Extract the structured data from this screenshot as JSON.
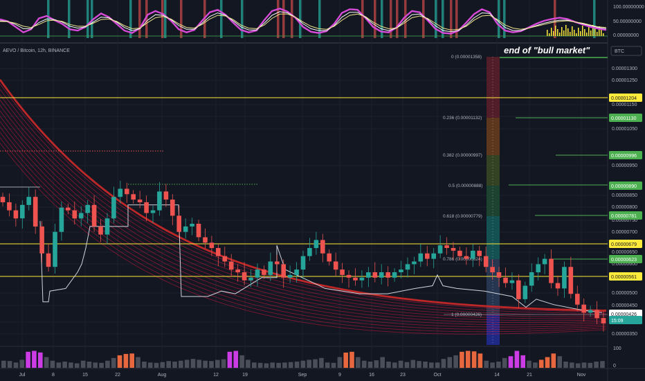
{
  "chart_data": [
    {
      "type": "line",
      "panel": "oscillator",
      "yticks": [
        "100.00000000",
        "50.00000000",
        "0.00000000"
      ],
      "ylim": [
        0,
        100
      ],
      "series": [
        {
          "color": "#d64ad8",
          "values": [
            55,
            48,
            30,
            12,
            22,
            58,
            66,
            52,
            40,
            22,
            18,
            30,
            55,
            74,
            62,
            40,
            18,
            10,
            26,
            70,
            82,
            72,
            50,
            22,
            12,
            20,
            50,
            78,
            86,
            70,
            44,
            20,
            12,
            18,
            52,
            82,
            90,
            80,
            60,
            30,
            14,
            10,
            16,
            40,
            76,
            88,
            86,
            60,
            30,
            15,
            12,
            28,
            60,
            82,
            78,
            52,
            24,
            10,
            8,
            18,
            44,
            72,
            88,
            78,
            40,
            18,
            12,
            16,
            28,
            40,
            50,
            56,
            60,
            56,
            46,
            38,
            30,
            24,
            20
          ]
        },
        {
          "color": "#ffffff",
          "values": [
            50,
            48,
            38,
            24,
            24,
            44,
            56,
            54,
            46,
            32,
            26,
            30,
            46,
            62,
            60,
            46,
            28,
            18,
            24,
            52,
            70,
            68,
            54,
            34,
            22,
            22,
            42,
            64,
            76,
            68,
            50,
            30,
            20,
            20,
            42,
            68,
            80,
            76,
            62,
            40,
            24,
            18,
            18,
            34,
            62,
            78,
            78,
            62,
            40,
            24,
            18,
            26,
            48,
            70,
            72,
            56,
            34,
            18,
            14,
            18,
            36,
            60,
            76,
            74,
            50,
            28,
            18,
            18,
            26,
            34,
            42,
            48,
            52,
            52,
            46,
            40,
            34,
            28,
            24
          ]
        },
        {
          "color": "#f0e68c",
          "values": [
            48,
            47,
            42,
            32,
            28,
            38,
            50,
            52,
            48,
            38,
            32,
            32,
            42,
            54,
            56,
            48,
            34,
            24,
            26,
            44,
            60,
            64,
            56,
            40,
            28,
            26,
            38,
            56,
            68,
            66,
            54,
            36,
            26,
            24,
            36,
            58,
            72,
            72,
            62,
            46,
            32,
            24,
            22,
            32,
            52,
            68,
            72,
            64,
            46,
            32,
            24,
            26,
            42,
            60,
            66,
            58,
            42,
            26,
            20,
            22,
            32,
            52,
            66,
            68,
            54,
            36,
            26,
            22,
            26,
            32,
            38,
            44,
            48,
            50,
            46,
            42,
            36,
            30,
            28
          ]
        }
      ]
    },
    {
      "type": "candlestick",
      "panel": "price",
      "title": "AEVO / Bitcoin, 12h, BINANCE",
      "xlabels": [
        "Jul",
        "8",
        "15",
        "22",
        "Aug",
        "12",
        "19",
        "Sep",
        "9",
        "16",
        "23",
        "Oct",
        "14",
        "21",
        "Nov"
      ],
      "yticks": [
        "0.00001300",
        "0.00001250",
        "0.00001150",
        "0.00001100",
        "0.00001050",
        "0.00000950",
        "0.00000850",
        "0.00000800",
        "0.00000750",
        "0.00000700",
        "0.00000650",
        "0.00000600",
        "0.00000500",
        "0.00000450",
        "0.00000400",
        "0.00000350"
      ],
      "ylim": [
        3.2e-06,
        1.39e-05
      ],
      "close": [
        8.5,
        8.2,
        7.9,
        8.4,
        8.7,
        7.6,
        6.6,
        6.1,
        7.4,
        8.3,
        8.2,
        7.9,
        8.1,
        8.4,
        7.6,
        7.3,
        7.9,
        8.7,
        9.0,
        8.8,
        8.6,
        8.5,
        8.1,
        8.2,
        8.9,
        8.6,
        8.0,
        7.4,
        7.6,
        7.7,
        7.2,
        7.0,
        6.8,
        6.5,
        6.3,
        6.0,
        5.9,
        5.6,
        5.7,
        6.0,
        5.8,
        6.3,
        6.2,
        5.7,
        5.8,
        6.0,
        6.5,
        6.8,
        7.1,
        6.6,
        6.3,
        6.0,
        5.8,
        5.7,
        5.6,
        5.7,
        5.9,
        5.7,
        5.9,
        5.7,
        5.9,
        6.0,
        6.2,
        6.3,
        6.6,
        6.4,
        6.6,
        6.9,
        6.8,
        6.7,
        6.5,
        6.4,
        6.7,
        6.5,
        6.1,
        5.9,
        5.7,
        5.5,
        5.6,
        4.9,
        5.4,
        5.9,
        6.2,
        6.4,
        5.5,
        5.3,
        6.1,
        5.1,
        4.7,
        4.4,
        4.5,
        4.2,
        4.0
      ]
    },
    {
      "type": "bar",
      "panel": "volume",
      "yticks": [
        "100",
        "0"
      ],
      "ylim": [
        0,
        120
      ],
      "values": [
        40,
        38,
        30,
        45,
        90,
        95,
        86,
        60,
        40,
        30,
        35,
        30,
        25,
        40,
        35,
        30,
        28,
        40,
        55,
        70,
        78,
        80,
        60,
        35,
        30,
        28,
        32,
        38,
        35,
        40,
        45,
        50,
        45,
        40,
        38,
        44,
        48,
        90,
        95,
        70,
        45,
        30,
        28,
        25,
        30,
        28,
        30,
        32,
        35,
        40,
        45,
        48,
        55,
        30,
        28,
        60,
        85,
        90,
        60,
        40,
        35,
        42,
        60,
        35,
        30,
        40,
        32,
        44,
        38,
        35,
        30,
        30,
        50,
        60,
        70,
        90,
        95,
        92,
        80,
        40,
        30,
        35,
        55,
        65,
        95,
        70,
        40,
        30,
        45,
        60,
        80,
        65,
        35,
        30,
        25,
        30,
        28,
        35,
        38
      ],
      "colors": {
        "green": "#26a69a",
        "red": "#ef5350",
        "pink": "#e040fb",
        "orange": "#ff7043"
      }
    }
  ],
  "header": {
    "symbol": "AEVO / Bitcoin, 12h, BINANCE",
    "annotation": "end of \"bull market\""
  },
  "currency_badge": "BTC",
  "fib": [
    {
      "label": "0 (0.00001358)",
      "color": "#787b86"
    },
    {
      "label": "0.236 (0.00001132)",
      "color": "#f23645"
    },
    {
      "label": "0.382 (0.00000997)",
      "color": "#ff9800"
    },
    {
      "label": "0.5 (0.00000888)",
      "color": "#4caf50"
    },
    {
      "label": "0.618 (0.00000779)",
      "color": "#089981"
    },
    {
      "label": "0.786 (0.00000624)",
      "color": "#00bcd4"
    },
    {
      "label": "1 (0.00000426)",
      "color": "#787b86"
    }
  ],
  "price_tags": [
    {
      "label": "0.00001204",
      "bg": "#ffeb3b",
      "fg": "#131722"
    },
    {
      "label": "0.00001130",
      "bg": "#4caf50",
      "fg": "#ffffff"
    },
    {
      "label": "0.00000996",
      "bg": "#4caf50",
      "fg": "#ffffff"
    },
    {
      "label": "0.00000890",
      "bg": "#4caf50",
      "fg": "#ffffff"
    },
    {
      "label": "0.00000781",
      "bg": "#4caf50",
      "fg": "#ffffff"
    },
    {
      "label": "0.00000679",
      "bg": "#ffeb3b",
      "fg": "#131722"
    },
    {
      "label": "0.00000623",
      "bg": "#4caf50",
      "fg": "#ffffff"
    },
    {
      "label": "0.00000561",
      "bg": "#ffeb3b",
      "fg": "#131722"
    },
    {
      "label": "0.00000426",
      "bg": "#ffffff",
      "fg": "#131722"
    },
    {
      "label": "15:09",
      "bg": "#26a69a",
      "fg": "#ffffff"
    }
  ],
  "colors": {
    "background": "#131722",
    "up": "#26a69a",
    "down": "#ef5350",
    "yellow_level": "#ffeb3b",
    "green_level": "#4caf50",
    "ribbon": "#ff1744"
  }
}
